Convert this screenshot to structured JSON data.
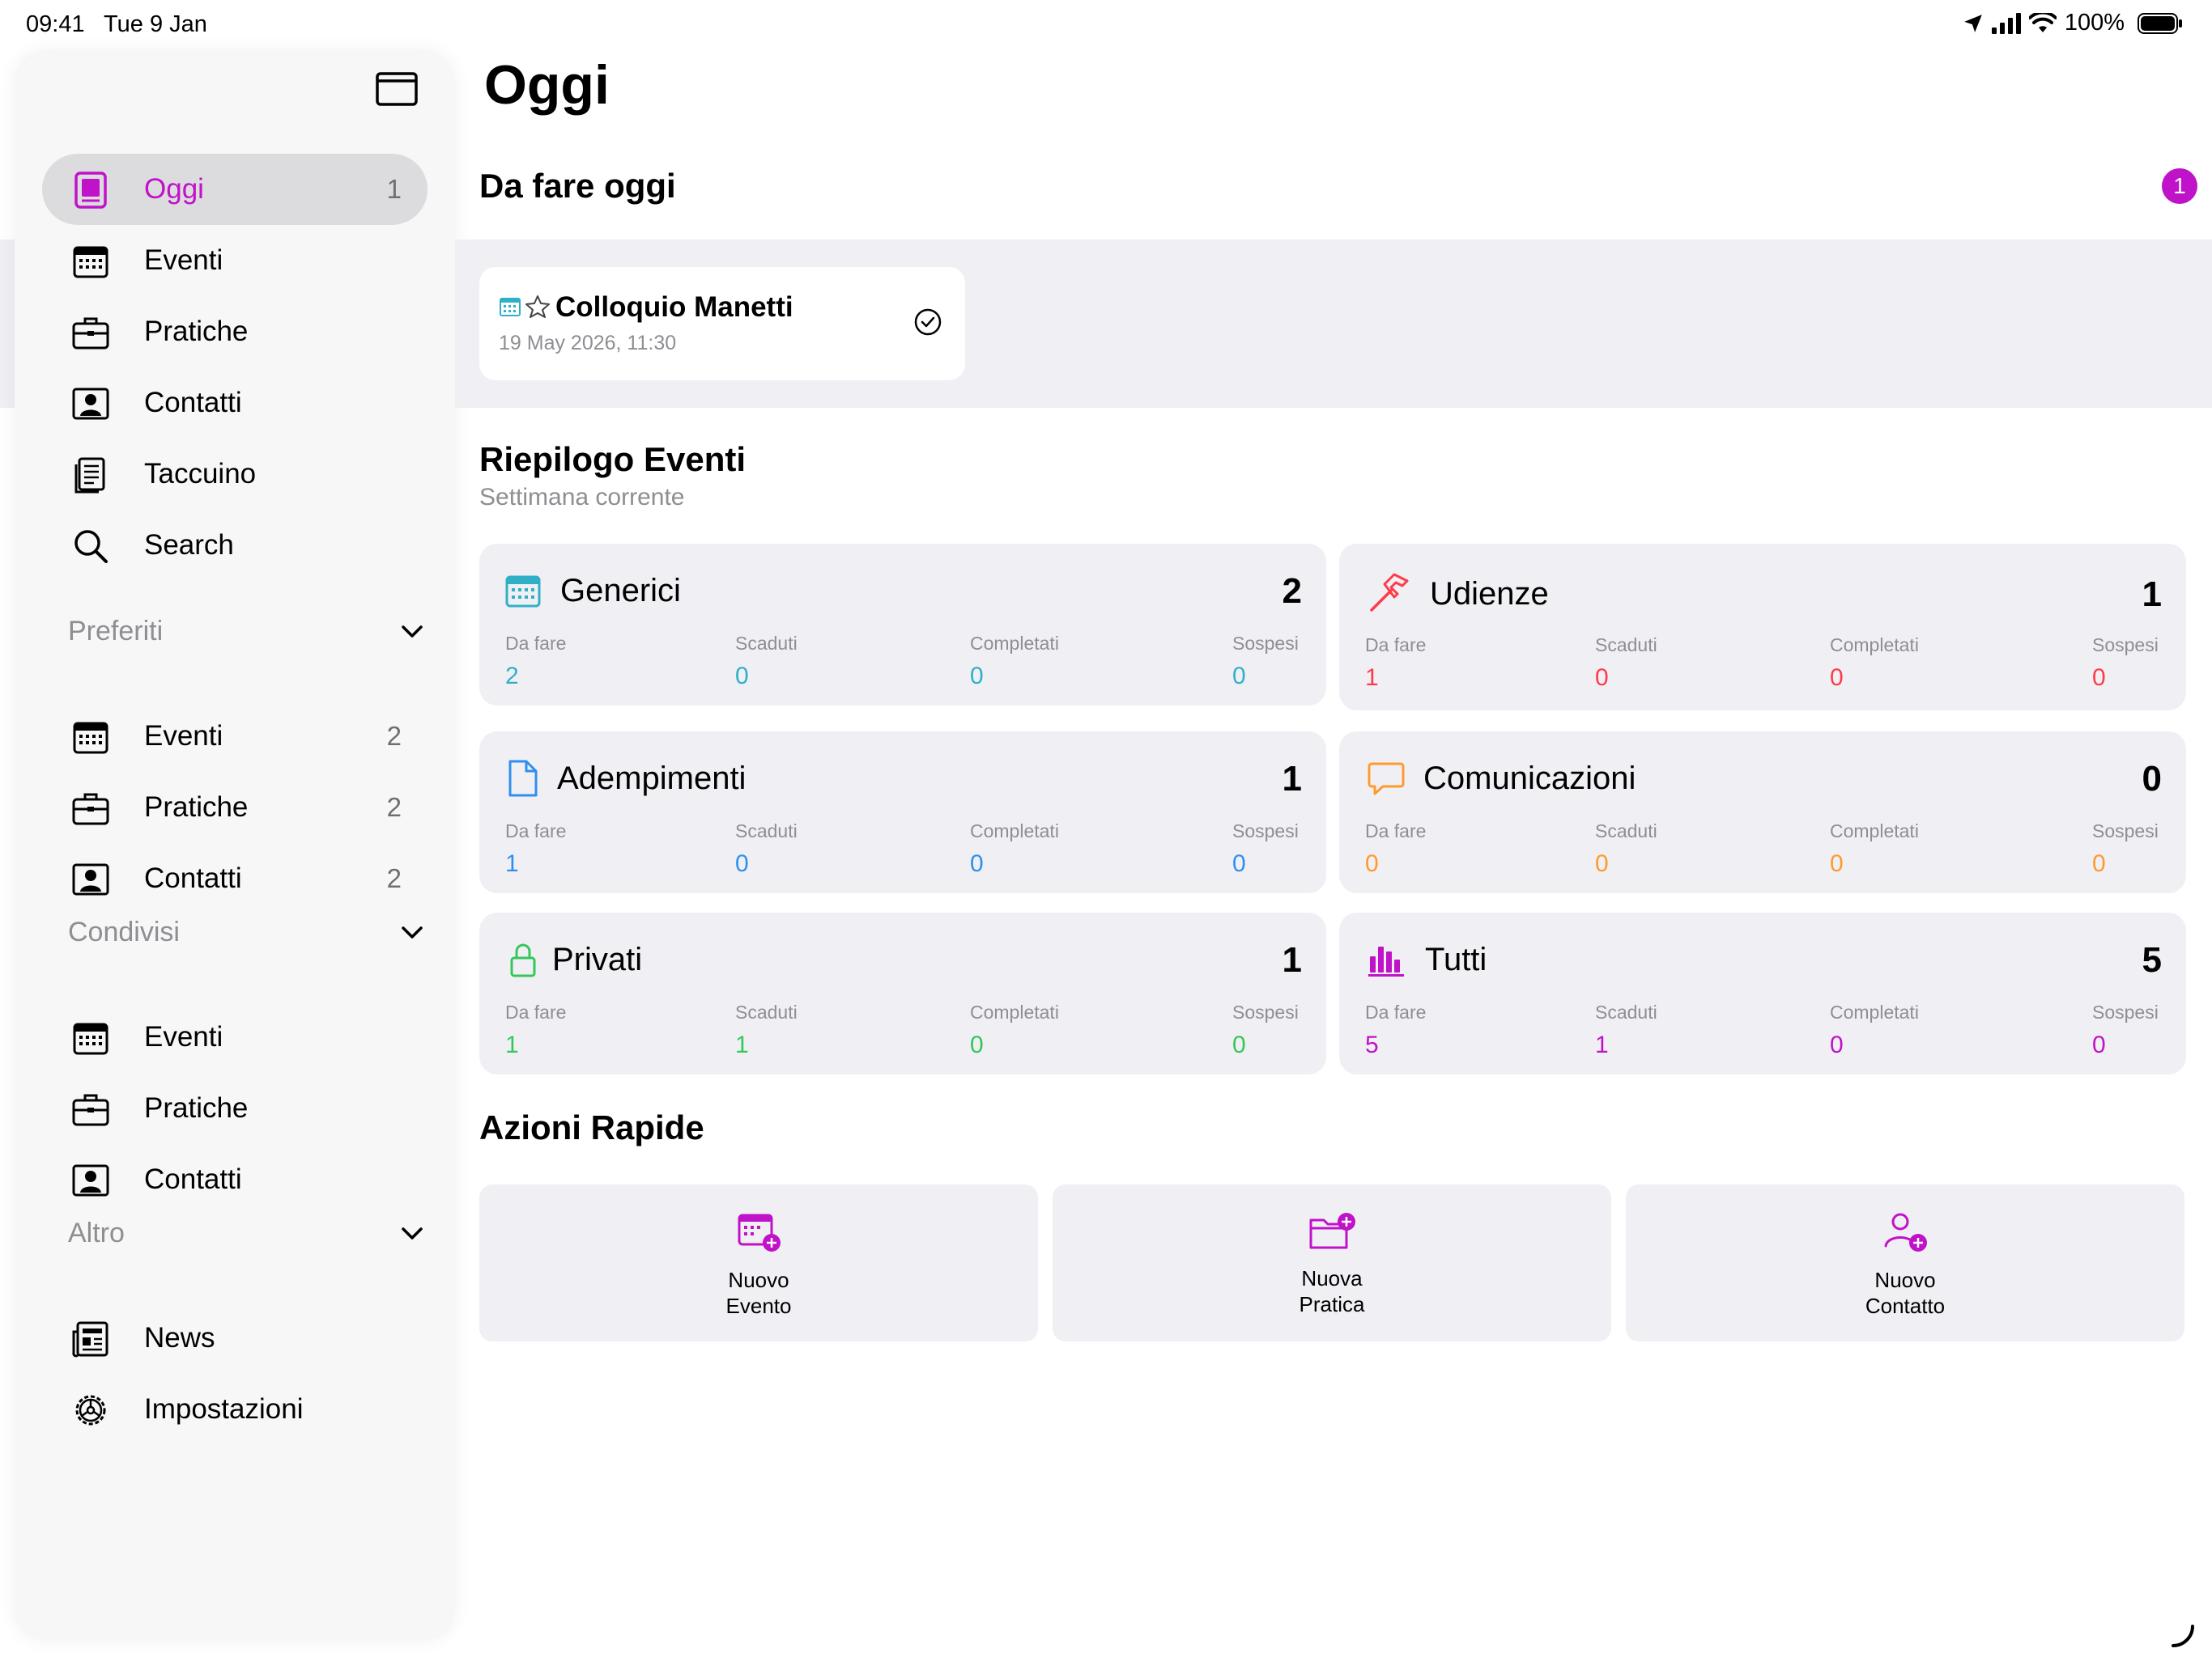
{
  "status_bar": {
    "time": "09:41",
    "date": "Tue 9 Jan",
    "battery": "100%"
  },
  "sidebar": {
    "main_items": [
      {
        "label": "Oggi",
        "count": "1",
        "icon": "today-icon"
      },
      {
        "label": "Eventi",
        "count": "",
        "icon": "calendar-icon"
      },
      {
        "label": "Pratiche",
        "count": "",
        "icon": "briefcase-icon"
      },
      {
        "label": "Contatti",
        "count": "",
        "icon": "contact-card-icon"
      },
      {
        "label": "Taccuino",
        "count": "",
        "icon": "notebook-icon"
      },
      {
        "label": "Search",
        "count": "",
        "icon": "search-icon"
      }
    ],
    "preferiti": {
      "title": "Preferiti",
      "items": [
        {
          "label": "Eventi",
          "count": "2",
          "icon": "calendar-icon"
        },
        {
          "label": "Pratiche",
          "count": "2",
          "icon": "briefcase-icon"
        },
        {
          "label": "Contatti",
          "count": "2",
          "icon": "contact-card-icon"
        }
      ]
    },
    "condivisi": {
      "title": "Condivisi",
      "items": [
        {
          "label": "Eventi",
          "count": "",
          "icon": "calendar-icon"
        },
        {
          "label": "Pratiche",
          "count": "",
          "icon": "briefcase-icon"
        },
        {
          "label": "Contatti",
          "count": "",
          "icon": "contact-card-icon"
        }
      ]
    },
    "altro": {
      "title": "Altro",
      "items": [
        {
          "label": "News",
          "count": "",
          "icon": "newspaper-icon"
        },
        {
          "label": "Impostazioni",
          "count": "",
          "icon": "settings-gear-icon"
        }
      ]
    }
  },
  "main": {
    "title": "Oggi",
    "todo": {
      "heading": "Da fare oggi",
      "badge": "1",
      "items": [
        {
          "title": "Colloquio Manetti",
          "date": "19 May 2026, 11:30"
        }
      ]
    },
    "summary": {
      "heading": "Riepilogo Eventi",
      "subheading": "Settimana corrente",
      "stat_labels": [
        "Da fare",
        "Scaduti",
        "Completati",
        "Sospesi"
      ],
      "cards": [
        {
          "title": "Generici",
          "total": "2",
          "values": [
            "2",
            "0",
            "0",
            "0"
          ],
          "color": "#30b0c7",
          "icon": "calendar-icon"
        },
        {
          "title": "Udienze",
          "total": "1",
          "values": [
            "1",
            "0",
            "0",
            "0"
          ],
          "color": "#ff3b4a",
          "icon": "gavel-hammer-icon"
        },
        {
          "title": "Adempimenti",
          "total": "1",
          "values": [
            "1",
            "0",
            "0",
            "0"
          ],
          "color": "#2f8ff0",
          "icon": "document-icon"
        },
        {
          "title": "Comunicazioni",
          "total": "0",
          "values": [
            "0",
            "0",
            "0",
            "0"
          ],
          "color": "#ff9a2e",
          "icon": "chat-bubble-icon"
        },
        {
          "title": "Privati",
          "total": "1",
          "values": [
            "1",
            "1",
            "0",
            "0"
          ],
          "color": "#34c759",
          "icon": "lock-icon"
        },
        {
          "title": "Tutti",
          "total": "5",
          "values": [
            "5",
            "1",
            "0",
            "0"
          ],
          "color": "#c012c8",
          "icon": "bar-chart-icon"
        }
      ]
    },
    "quick_actions": {
      "heading": "Azioni Rapide",
      "items": [
        {
          "line1": "Nuovo",
          "line2": "Evento",
          "icon": "new-event-icon"
        },
        {
          "line1": "Nuova",
          "line2": "Pratica",
          "icon": "new-folder-icon"
        },
        {
          "line1": "Nuovo",
          "line2": "Contatto",
          "icon": "add-contact-icon"
        }
      ]
    }
  },
  "colors": {
    "accent": "#c012c8",
    "card_bg": "#f0f0f4",
    "muted": "#8e8e93"
  }
}
